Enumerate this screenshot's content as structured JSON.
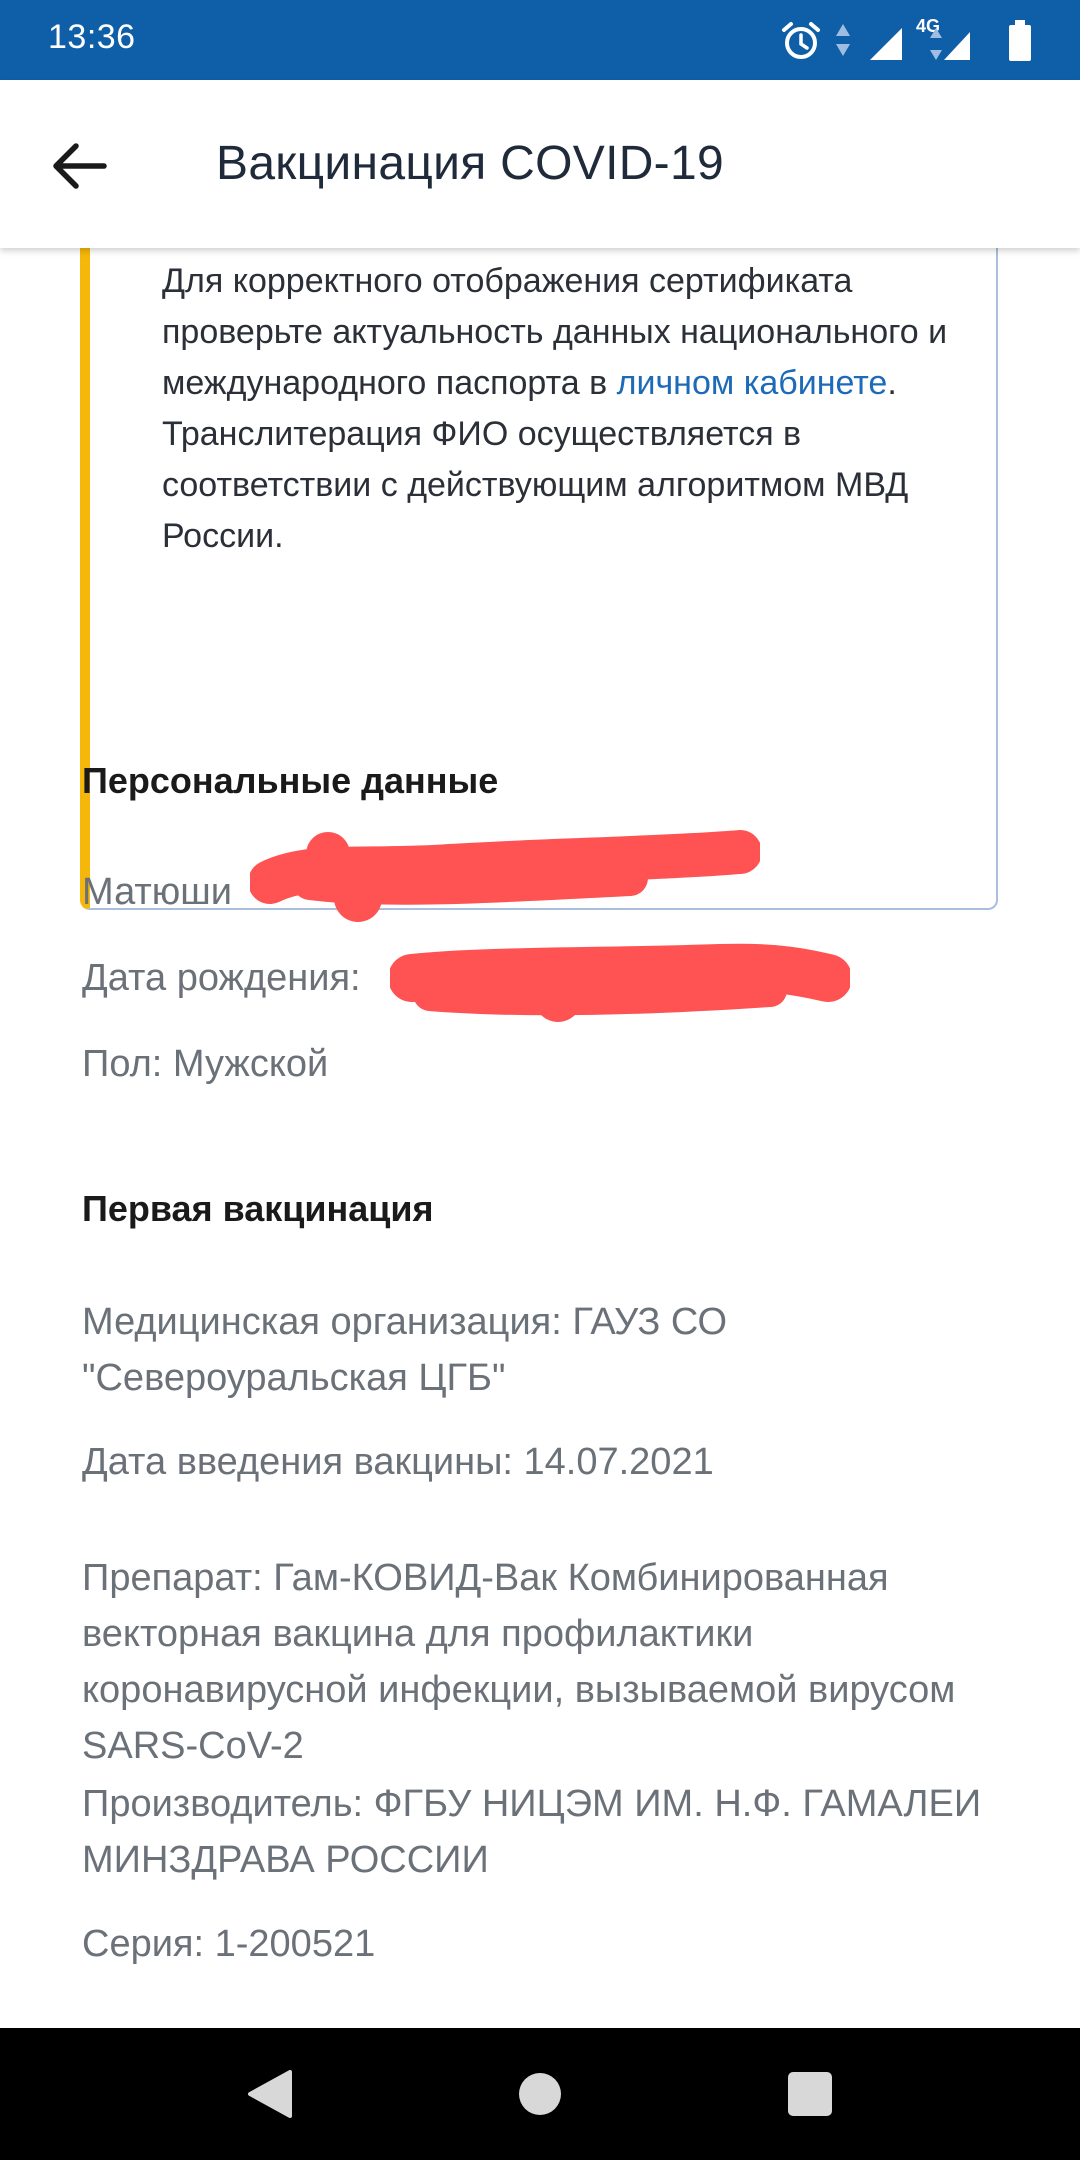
{
  "status_bar": {
    "time": "13:36",
    "network": "4G",
    "icons": [
      "alarm-icon",
      "data-arrows-icon",
      "signal-icon",
      "battery-icon"
    ],
    "background": "#0f5fa8"
  },
  "header": {
    "title": "Вакцинация COVID-19",
    "back_icon": "arrow-left-icon"
  },
  "notice": {
    "text_before_link": "Для корректного отображения сертификата проверьте актуальность данных национального и международного паспорта в ",
    "link_text": "личном кабинете",
    "text_after_link": ".",
    "second_paragraph": "Транслитерация ФИО осуществляется в соответствии с действующим алгоритмом МВД России.",
    "accent_color": "#f5b70a",
    "link_color": "#1d6bb8"
  },
  "personal": {
    "title": "Персональные данные",
    "name_visible_part": "Матюши",
    "birth_label": "Дата рождения:",
    "gender": "Пол: Мужской"
  },
  "first_vaccination": {
    "title": "Первая вакцинация",
    "organization": "Медицинская организация: ГАУЗ СО \"Североуральская ЦГБ\"",
    "date": "Дата введения вакцины: 14.07.2021",
    "drug": "Препарат: Гам-КОВИД-Вак Комбинированная векторная вакцина для профилактики коронавирусной инфекции, вызываемой вирусом SARS-CoV-2",
    "manufacturer": "Производитель: ФГБУ НИЦЭМ ИМ. Н.Ф. ГАМАЛЕИ МИНЗДРАВА РОССИИ",
    "series": "Серия: 1-200521"
  },
  "nav_bar": {
    "buttons": [
      "back-triangle-icon",
      "home-circle-icon",
      "recents-square-icon"
    ]
  }
}
